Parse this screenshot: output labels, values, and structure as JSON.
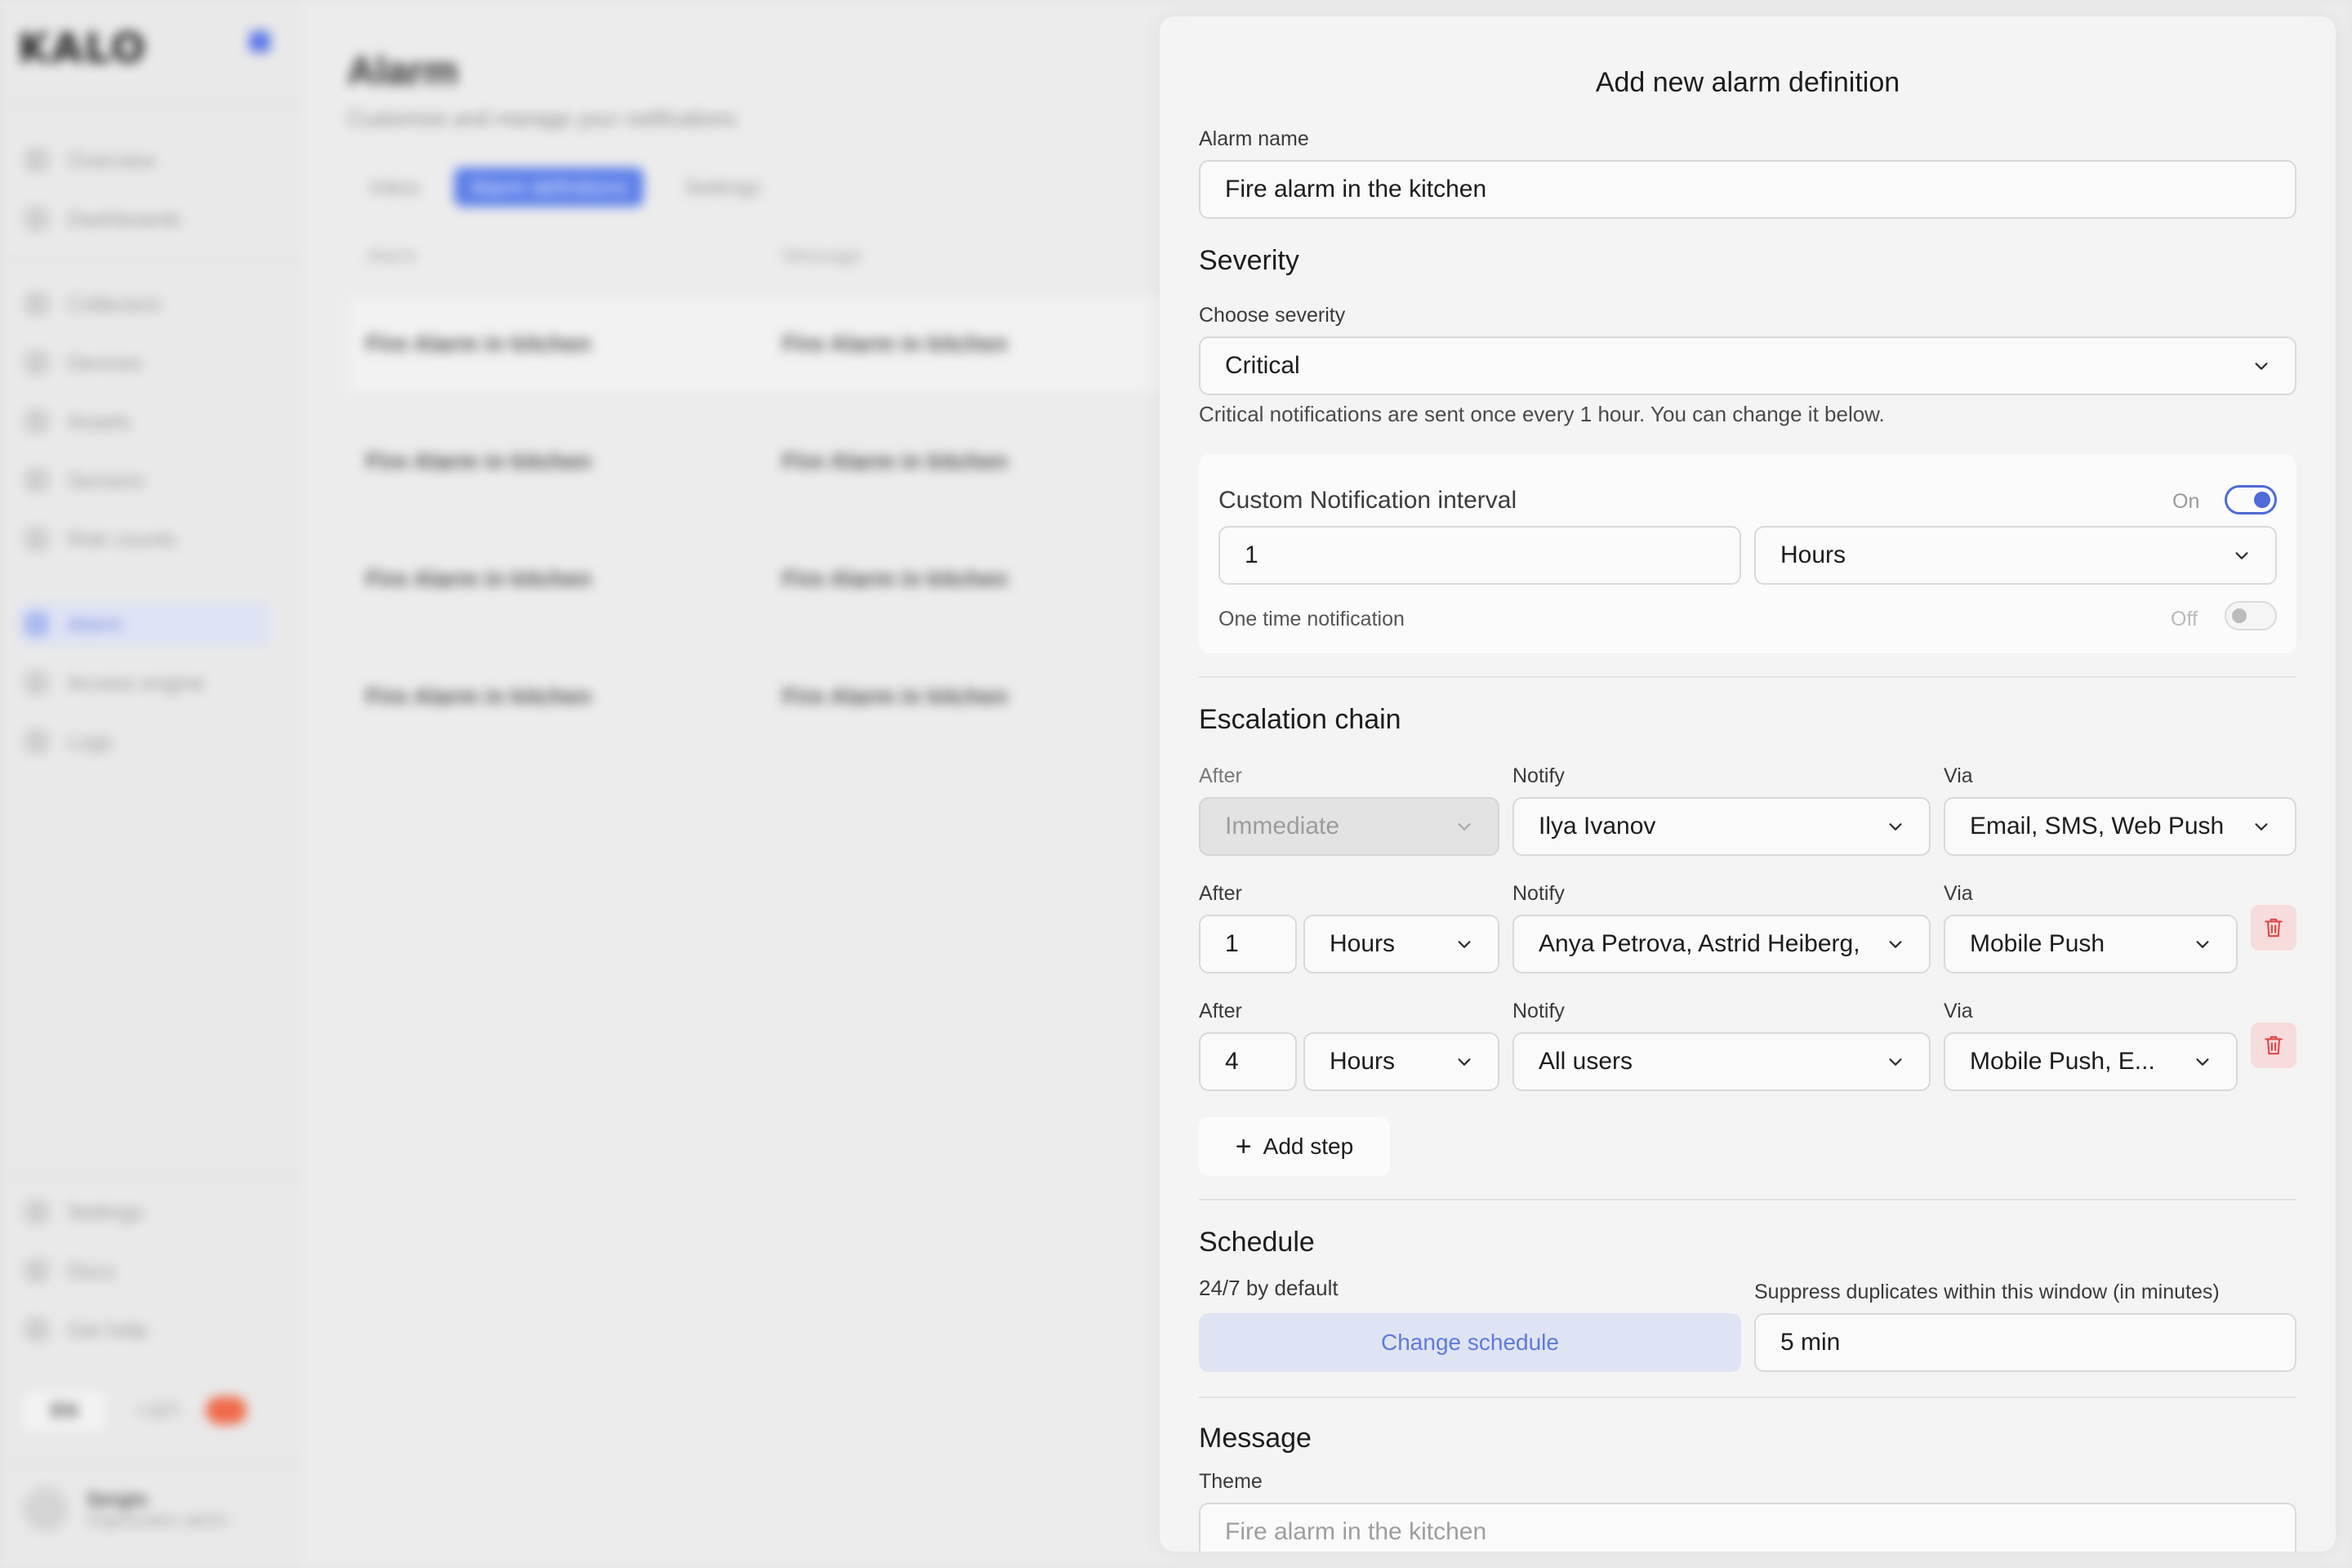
{
  "background": {
    "logo": "KALO",
    "nav": [
      "Overview",
      "Dashboards",
      "Collectors",
      "Devices",
      "Assets",
      "Sensors",
      "Risk counts",
      "Alarm",
      "Access engine",
      "Logs"
    ],
    "bottom_nav": [
      "Settings",
      "Docs",
      "Get help"
    ],
    "lang": "EN",
    "theme_label": "Light",
    "user_name": "Sergio",
    "user_role": "Organization admin",
    "page_title": "Alarm",
    "page_subtitle": "Customize and manage your notifications",
    "tabs": [
      "Inbox",
      "Alarm definitions",
      "Settings"
    ],
    "columns": [
      "Alarm",
      "Message"
    ],
    "rows": [
      [
        "Fire Alarm in kitchen",
        "Fire Alarm in kitchen"
      ],
      [
        "Fire Alarm in kitchen",
        "Fire Alarm in kitchen"
      ],
      [
        "Fire Alarm in kitchen",
        "Fire Alarm in kitchen"
      ],
      [
        "Fire Alarm in kitchen",
        "Fire Alarm in kitchen"
      ]
    ]
  },
  "panel": {
    "title": "Add new alarm definition",
    "alarm_name_label": "Alarm name",
    "alarm_name_value": "Fire alarm in the kitchen",
    "severity": {
      "heading": "Severity",
      "label": "Choose severity",
      "value": "Critical",
      "note": "Critical notifications are sent once every 1 hour. You can change it below."
    },
    "custom_interval": {
      "title": "Custom Notification interval",
      "state_label": "On",
      "enabled": true,
      "amount": "1",
      "unit": "Hours",
      "one_time_label": "One time notification",
      "one_time_state_label": "Off",
      "one_time_enabled": false
    },
    "escalation": {
      "heading": "Escalation chain",
      "after_label": "After",
      "notify_label": "Notify",
      "via_label": "Via",
      "steps": [
        {
          "after": "Immediate",
          "notify": "Ilya Ivanov",
          "via": "Email, SMS, Web Push"
        },
        {
          "amount": "1",
          "unit": "Hours",
          "notify": "Anya Petrova, Astrid Heiberg,",
          "via": "Mobile Push"
        },
        {
          "amount": "4",
          "unit": "Hours",
          "notify": "All users",
          "via": "Mobile Push, E..."
        }
      ],
      "add_step_label": "Add step"
    },
    "schedule": {
      "heading": "Schedule",
      "default_label": "24/7 by default",
      "change_button": "Change schedule",
      "suppress_label": "Suppress duplicates within this window (in minutes)",
      "suppress_value": "5 min"
    },
    "message": {
      "heading": "Message",
      "theme_label": "Theme",
      "theme_placeholder": "Fire alarm in the kitchen"
    }
  },
  "colors": {
    "accent": "#4e6bd6",
    "danger": "#e04848",
    "panel_bg": "#f4f4f4"
  }
}
